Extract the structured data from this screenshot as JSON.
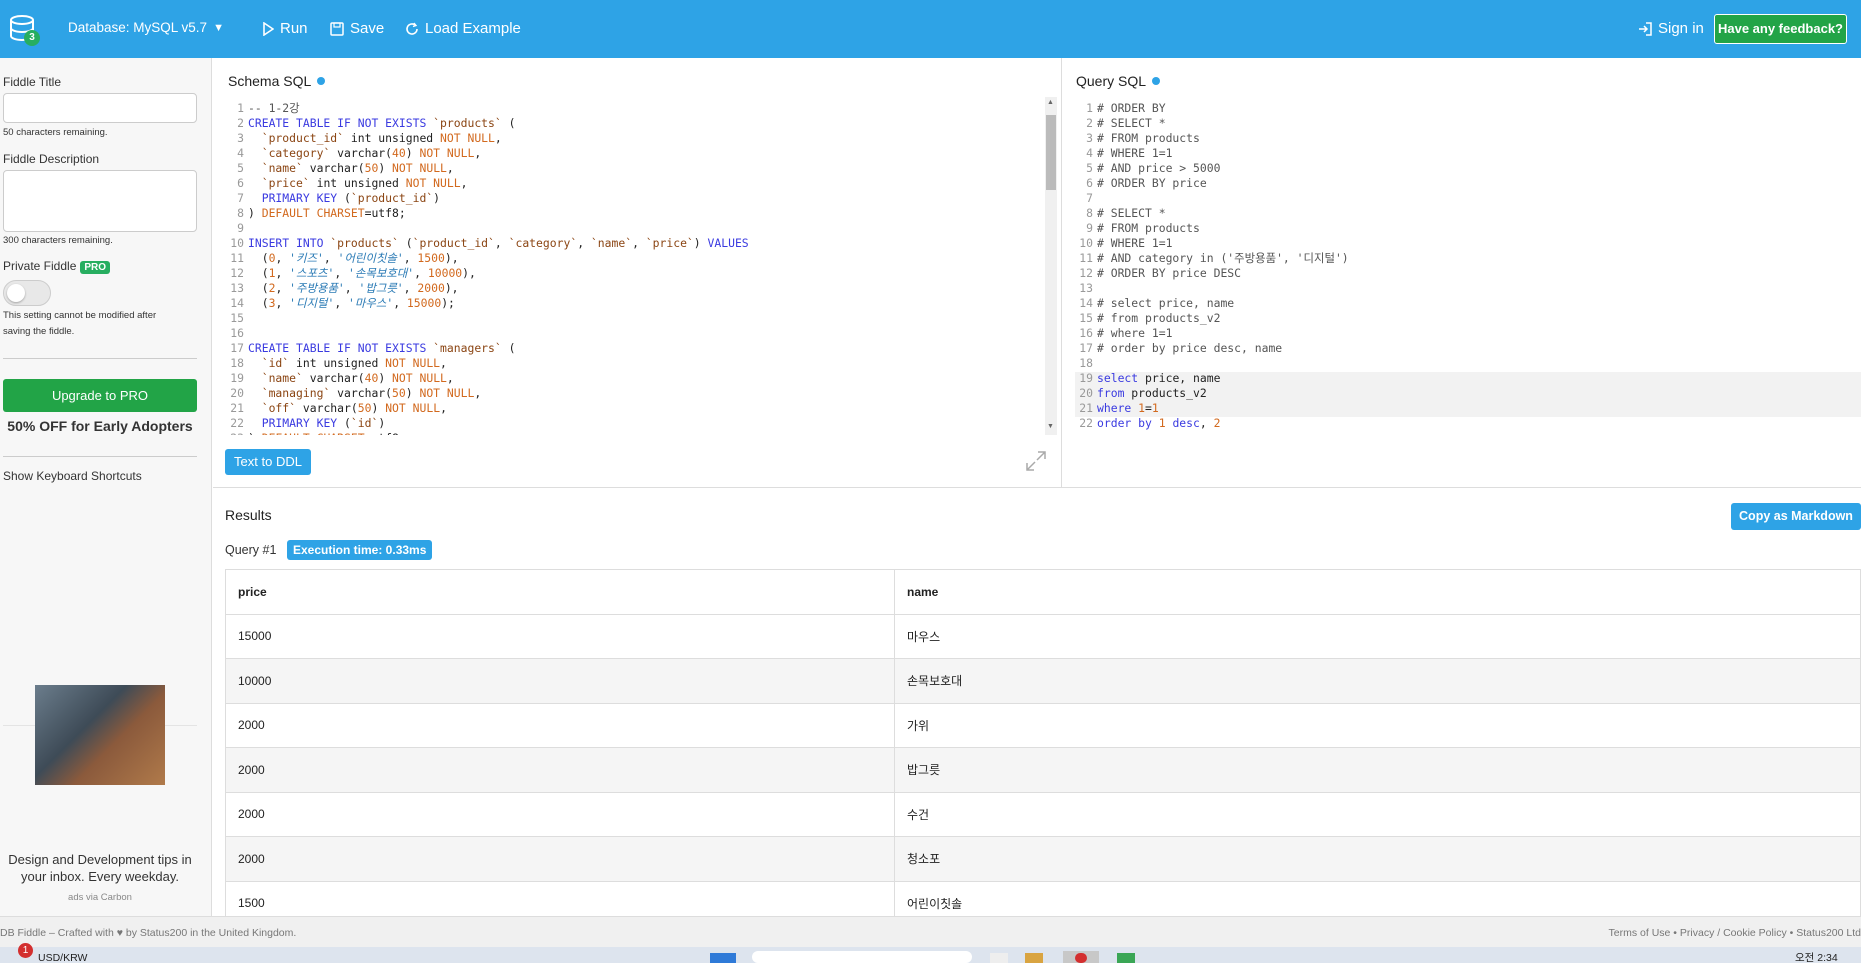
{
  "header": {
    "db_badge": "3",
    "database_label": "Database: MySQL v5.7",
    "run": "Run",
    "save": "Save",
    "load_example": "Load Example",
    "sign_in": "Sign in",
    "feedback": "Have any feedback?"
  },
  "sidebar": {
    "fiddle_title_label": "Fiddle Title",
    "fiddle_title_value": "",
    "title_remaining": "50 characters remaining.",
    "description_label": "Fiddle Description",
    "description_remaining": "300 characters remaining.",
    "private_label": "Private Fiddle",
    "pro_badge": "PRO",
    "private_note_1": "This setting cannot be modified after",
    "private_note_2": "saving the fiddle.",
    "upgrade": "Upgrade to PRO",
    "offer": "50% OFF for Early Adopters",
    "shortcuts": "Show Keyboard Shortcuts",
    "ad_text_1": "Design and Development tips in",
    "ad_text_2": "your inbox. Every weekday.",
    "ad_via": "ads via Carbon"
  },
  "schema": {
    "title": "Schema SQL",
    "text_to_ddl": "Text to DDL"
  },
  "query": {
    "title": "Query SQL"
  },
  "results": {
    "title": "Results",
    "copy_markdown": "Copy as Markdown",
    "query_label": "Query #1",
    "exec_time": "Execution time: 0.33ms",
    "columns": [
      "price",
      "name"
    ],
    "rows": [
      [
        "15000",
        "마우스"
      ],
      [
        "10000",
        "손목보호대"
      ],
      [
        "2000",
        "가위"
      ],
      [
        "2000",
        "밥그릇"
      ],
      [
        "2000",
        "수건"
      ],
      [
        "2000",
        "청소포"
      ],
      [
        "1500",
        "어린이칫솔"
      ]
    ]
  },
  "footer": {
    "left": "DB Fiddle – Crafted with ♥ by Status200 in the United Kingdom.",
    "right": "Terms of Use • Privacy / Cookie Policy • Status200 Ltd"
  },
  "taskbar": {
    "notification": "1",
    "ticker": "USD/KRW",
    "time": "오전 2:34"
  },
  "colors": {
    "header_bg": "#2ea3e6",
    "green": "#22a447",
    "accent": "#2ea3e6"
  }
}
